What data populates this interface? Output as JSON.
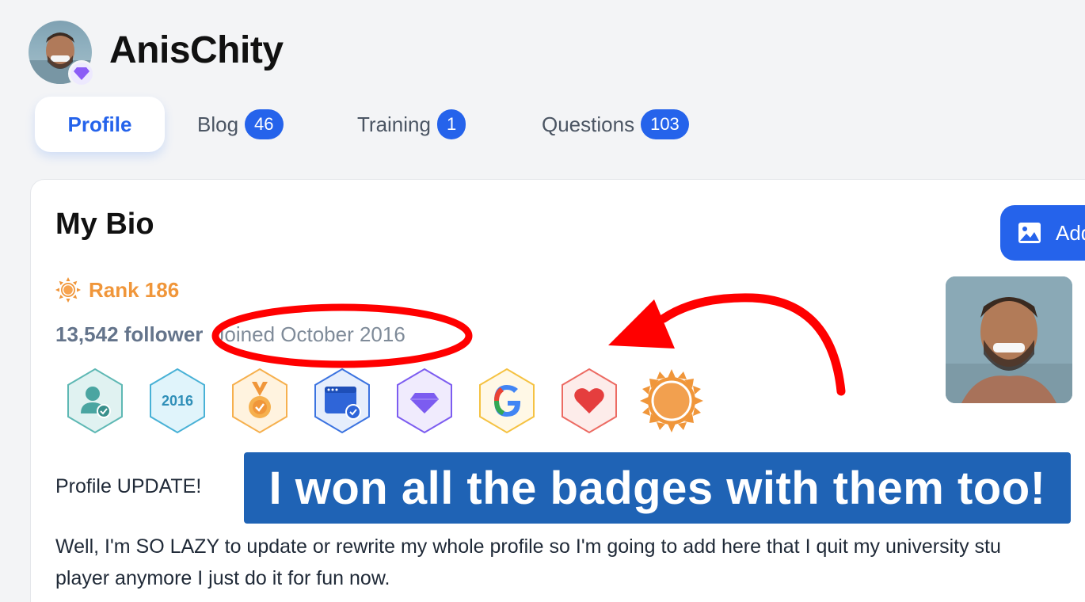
{
  "header": {
    "username": "AnisChity"
  },
  "tabs": [
    {
      "label": "Profile",
      "active": true
    },
    {
      "label": "Blog",
      "count": "46"
    },
    {
      "label": "Training",
      "count": "1"
    },
    {
      "label": "Questions",
      "count": "103"
    }
  ],
  "bio": {
    "title": "My Bio",
    "add_button_label": "Add",
    "rank_label": "Rank 186",
    "followers": "13,542 follower",
    "joined": "Joined October 2016",
    "badges": [
      "verified-user-badge",
      "year-2016-badge",
      "medal-badge",
      "browser-check-badge",
      "diamond-badge",
      "google-badge",
      "heart-badge",
      "sun-badge"
    ],
    "badge_year_text": "2016",
    "text_line1": "Profile UPDATE!",
    "text_para_line1": "Well, I'm SO LAZY to update or rewrite my whole profile so I'm going to add here that I quit my university stu",
    "text_para_line2": "player anymore I just do it for fun now."
  },
  "overlay": {
    "banner_text": "I won all the badges with them too!"
  },
  "colors": {
    "accent": "#2563eb",
    "rank": "#f0963a",
    "annotation_red": "#ff0000",
    "banner_bg": "#1f63b5"
  }
}
